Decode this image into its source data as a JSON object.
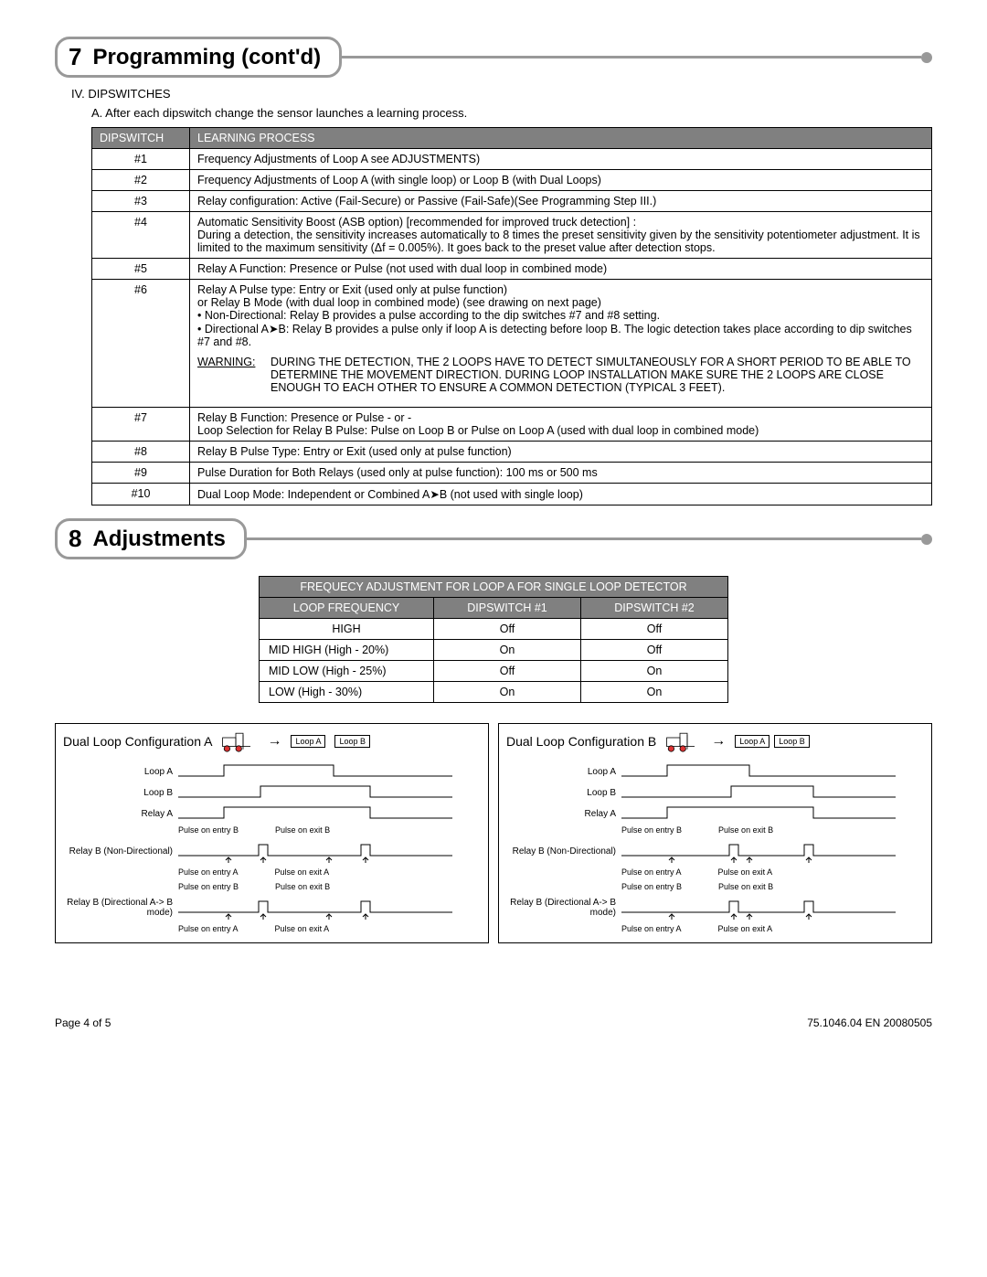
{
  "section7": {
    "num": "7",
    "title": "Programming (cont'd)"
  },
  "dip_intro_main": "IV.  DIPSWITCHES",
  "dip_intro_sub": "A.  After each dipswitch change the sensor launches a learning process.",
  "dipHeader": {
    "col1": "DIPSWITCH",
    "col2": "LEARNING PROCESS"
  },
  "d1n": "#1",
  "d1t": "Frequency Adjustments of Loop A  see ADJUSTMENTS)",
  "d2n": "#2",
  "d2t": "Frequency Adjustments of Loop A (with single loop) or Loop B (with Dual Loops)",
  "d3n": "#3",
  "d3t": "Relay configuration: Active (Fail-Secure) or Passive (Fail-Safe)(See Programming Step III.)",
  "d4n": "#4",
  "d4t1": "Automatic Sensitivity Boost (ASB option)  [recommended for improved truck detection] :",
  "d4t2": "During a detection, the sensitivity increases automatically to 8 times the preset sensitivity given by the sensitivity potentiometer adjustment. It is limited to the maximum sensitivity (Δf = 0.005%). It goes back to the preset value after detection stops.",
  "d5n": "#5",
  "d5t": "Relay A Function:  Presence or Pulse  (not used with dual loop in combined mode)",
  "d6n": "#6",
  "d6a": "Relay A Pulse type:  Entry or Exit  (used only at pulse function)",
  "d6b": "or Relay B Mode (with dual loop in combined mode) (see drawing on next page)",
  "d6c": "• Non-Directional:  Relay B provides a pulse according to the dip switches #7 and #8 setting.",
  "d6d": "• Directional A➤B:  Relay B provides a pulse only if loop A is detecting before loop B.  The logic detection takes place according to dip switches #7 and #8.",
  "d6warnLabel": "WARNING:",
  "d6warn": "DURING THE DETECTION, THE 2 LOOPS HAVE TO DETECT SIMULTANEOUSLY FOR A SHORT PERIOD TO BE ABLE TO DETERMINE THE MOVEMENT DIRECTION.  DURING LOOP INSTALLATION MAKE SURE THE 2 LOOPS ARE CLOSE ENOUGH TO EACH OTHER TO ENSURE A COMMON DETECTION (TYPICAL 3 FEET).",
  "d7n": "#7",
  "d7a": "Relay B Function:  Presence or Pulse  - or -",
  "d7b": "Loop Selection for Relay B Pulse:  Pulse on Loop B or Pulse on Loop A (used with dual loop in combined mode)",
  "d8n": "#8",
  "d8t": "Relay B Pulse Type:  Entry or Exit  (used only at pulse function)",
  "d9n": "#9",
  "d9t": "Pulse Duration for Both Relays (used only at pulse function):  100 ms or 500 ms",
  "d10n": "#10",
  "d10t": "Dual Loop Mode:  Independent or Combined A➤B  (not used with single loop)",
  "section8": {
    "num": "8",
    "title": "Adjustments"
  },
  "freqTitle": "FREQUECY ADJUSTMENT FOR LOOP A FOR SINGLE LOOP DETECTOR",
  "freqH1": "LOOP FREQUENCY",
  "freqH2": "DIPSWITCH #1",
  "freqH3": "DIPSWITCH #2",
  "fr1a": "HIGH",
  "fr1b": "Off",
  "fr1c": "Off",
  "fr2a": "MID HIGH (High - 20%)",
  "fr2b": "On",
  "fr2c": "Off",
  "fr3a": "MID LOW (High - 25%)",
  "fr3b": "Off",
  "fr3c": "On",
  "fr4a": "LOW (High - 30%)",
  "fr4b": "On",
  "fr4c": "On",
  "diaA_title": "Dual Loop Configuration A",
  "diaB_title": "Dual Loop Configuration B",
  "loopA_lbl": "Loop A",
  "loopB_lbl": "Loop B",
  "relayA_lbl": "Relay A",
  "relayB_nd": "Relay B (Non-Directional)",
  "relayB_dir": "Relay B (Directional A-> B  mode)",
  "p_entryB": "Pulse on entry B",
  "p_exitB": "Pulse on exit B",
  "p_entryA": "Pulse on entry A",
  "p_exitA": "Pulse on exit A",
  "footerLeft": "Page 4 of 5",
  "footerRight": "75.1046.04   EN   20080505"
}
